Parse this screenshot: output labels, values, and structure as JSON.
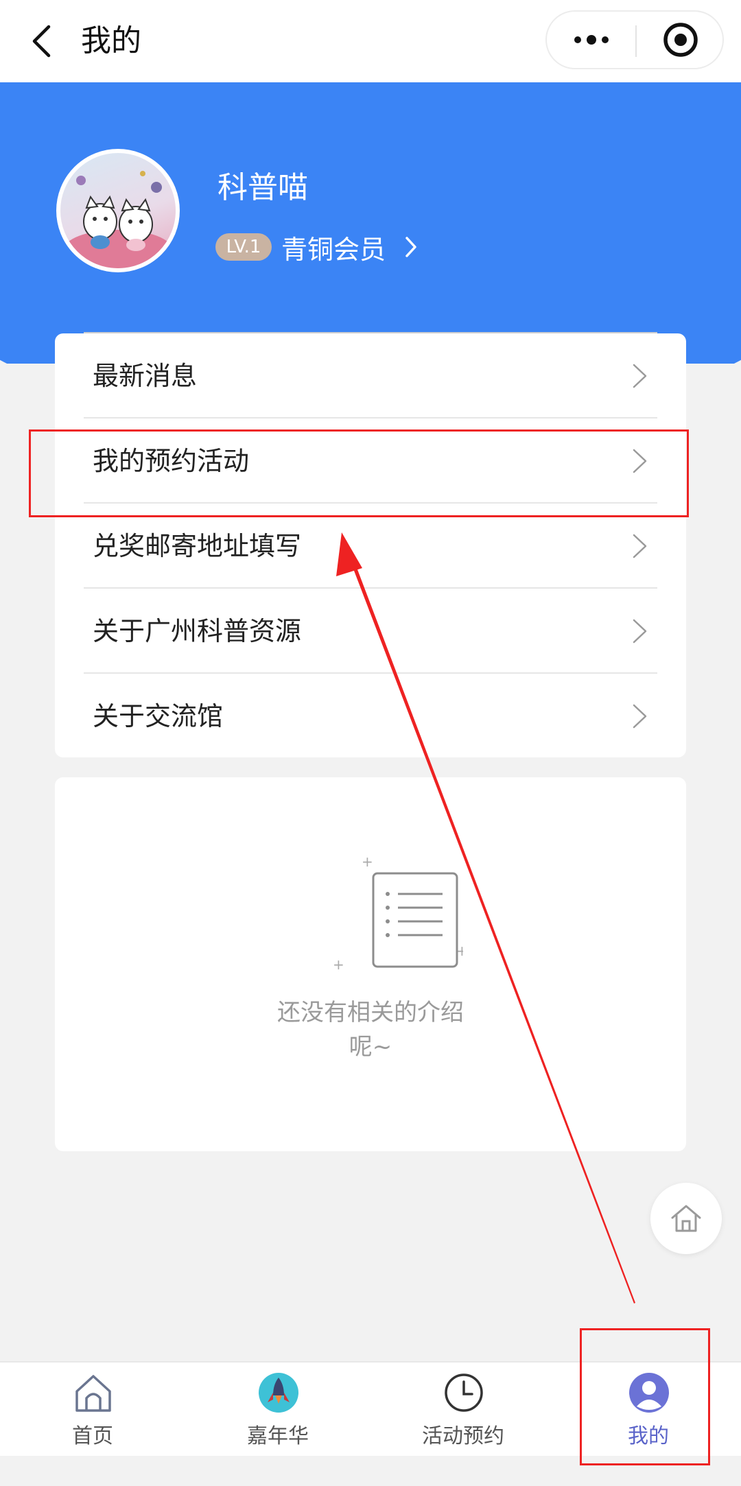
{
  "topbar": {
    "title": "我的"
  },
  "profile": {
    "username": "科普喵",
    "level": "LV.1",
    "member_label": "青铜会员"
  },
  "menu": {
    "items": [
      {
        "label": "最新消息"
      },
      {
        "label": "我的预约活动"
      },
      {
        "label": "兑奖邮寄地址填写"
      },
      {
        "label": "关于广州科普资源"
      },
      {
        "label": "关于交流馆"
      }
    ]
  },
  "empty": {
    "line1": "还没有相关的介绍",
    "line2": "呢~"
  },
  "tabbar": {
    "tabs": [
      {
        "label": "首页",
        "icon": "home-icon"
      },
      {
        "label": "嘉年华",
        "icon": "rocket-icon"
      },
      {
        "label": "活动预约",
        "icon": "clock-icon"
      },
      {
        "label": "我的",
        "icon": "user-icon",
        "active": true
      }
    ]
  },
  "colors": {
    "header_blue": "#3b84f5",
    "active_tab": "#5a63c9",
    "annotation_red": "#ee2222"
  }
}
